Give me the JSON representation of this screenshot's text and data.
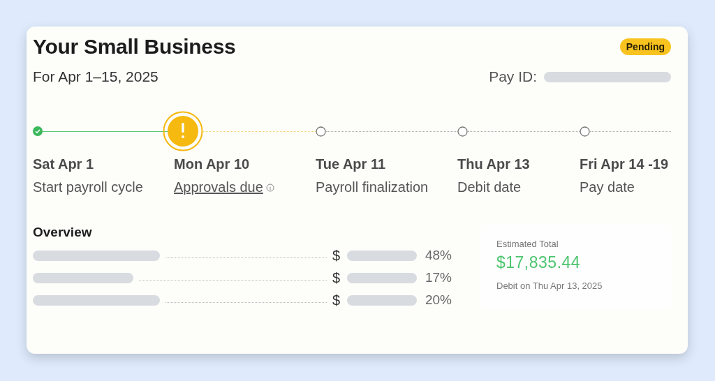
{
  "header": {
    "title": "Your Small Business",
    "badge": "Pending",
    "period": "For Apr 1–15, 2025",
    "pay_id_label": "Pay ID:"
  },
  "timeline": [
    {
      "kind": "done",
      "date": "Sat Apr 1",
      "label": "Start payroll cycle",
      "link": false
    },
    {
      "kind": "warning",
      "date": "Mon Apr 10",
      "label": "Approvals due",
      "link": true
    },
    {
      "kind": "upcoming",
      "date": "Tue Apr 11",
      "label": "Payroll finalization",
      "link": false
    },
    {
      "kind": "upcoming",
      "date": "Thu Apr 13",
      "label": "Debit date",
      "link": false
    },
    {
      "kind": "upcoming",
      "date": "Fri Apr 14 -19",
      "label": "Pay date",
      "link": false
    }
  ],
  "overview": {
    "title": "Overview",
    "rows": [
      {
        "currency": "$",
        "percent": "48%"
      },
      {
        "currency": "$",
        "percent": "17%"
      },
      {
        "currency": "$",
        "percent": "20%"
      }
    ]
  },
  "estimate": {
    "label": "Estimated Total",
    "amount": "$17,835.44",
    "note": "Debit on Thu Apr 13, 2025"
  }
}
